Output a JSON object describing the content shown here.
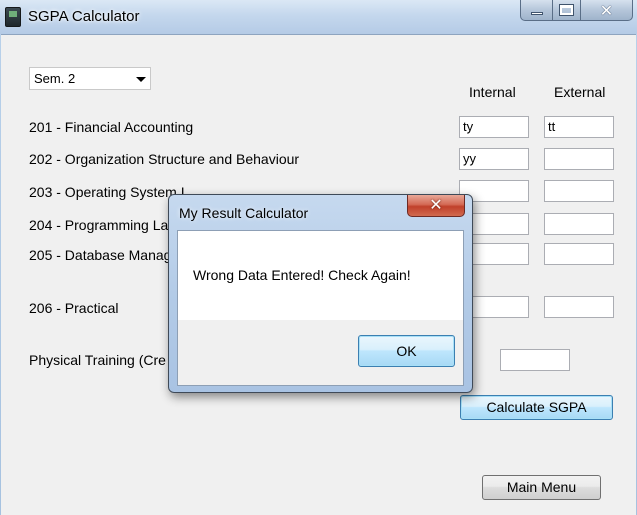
{
  "window": {
    "title": "SGPA Calculator",
    "caption_close": "✕"
  },
  "semester": {
    "selected": "Sem. 2"
  },
  "columns": {
    "internal": "Internal",
    "external": "External"
  },
  "subjects": [
    {
      "label": "201 - Financial Accounting",
      "internal": "ty",
      "external": "tt"
    },
    {
      "label": "202 - Organization Structure and Behaviour",
      "internal": "yy",
      "external": ""
    },
    {
      "label": "203 - Operating System I",
      "internal": "",
      "external": ""
    },
    {
      "label": "204 - Programming La",
      "internal": "",
      "external": ""
    },
    {
      "label": "205 - Database Manag",
      "internal": "",
      "external": ""
    },
    {
      "label": "206 - Practical",
      "internal": "",
      "external": ""
    }
  ],
  "physical_training": {
    "label": "Physical Training (Cre",
    "value": ""
  },
  "buttons": {
    "calculate": "Calculate SGPA",
    "main_menu": "Main Menu"
  },
  "dialog": {
    "title": "My Result Calculator",
    "close_glyph": "✕",
    "message": "Wrong Data Entered! Check Again!",
    "ok": "OK"
  },
  "colors": {
    "accent_button_border": "#3c7fb1",
    "dialog_close_red": "#c0402a",
    "client_bg": "#f0f0f0"
  }
}
